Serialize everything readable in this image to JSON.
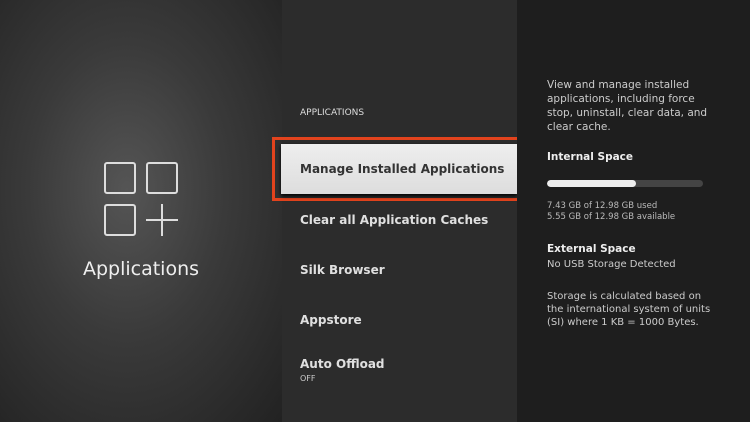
{
  "left": {
    "title": "Applications",
    "icon": "apps-grid-plus-icon"
  },
  "menu": {
    "section": "APPLICATIONS",
    "items": [
      {
        "label": "Manage Installed Applications"
      },
      {
        "label": "Clear all Application Caches"
      },
      {
        "label": "Silk Browser"
      },
      {
        "label": "Appstore"
      },
      {
        "label": "Auto Offload",
        "sub": "OFF"
      }
    ]
  },
  "info": {
    "description": "View and manage installed applications, including force stop, uninstall, clear data, and clear cache.",
    "internal_title": "Internal Space",
    "internal_used_fraction": 0.572,
    "used": "7.43 GB of 12.98 GB used",
    "available": "5.55 GB of 12.98 GB available",
    "external_title": "External Space",
    "external_status": "No USB Storage Detected",
    "note": "Storage is calculated based on the international system of units (SI) where 1 KB = 1000 Bytes."
  },
  "colors": {
    "highlight": "#e2431d"
  }
}
